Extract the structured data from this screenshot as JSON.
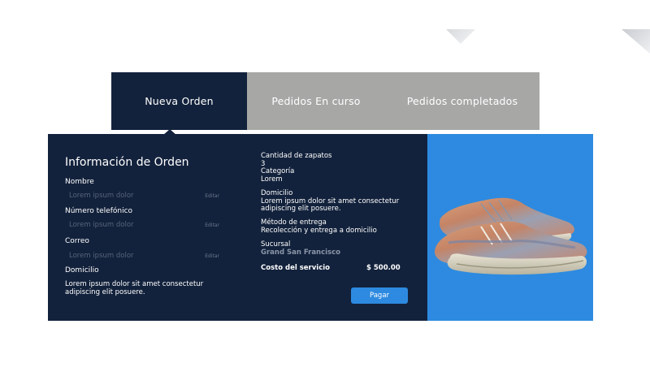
{
  "tabs": [
    {
      "label": "Nueva Orden",
      "active": true
    },
    {
      "label": "Pedidos En curso",
      "active": false
    },
    {
      "label": "Pedidos completados",
      "active": false
    }
  ],
  "form": {
    "title": "Información de Orden",
    "fields": [
      {
        "label": "Nombre",
        "placeholder": "Lorem ipsum dolor",
        "edit": "Editar"
      },
      {
        "label": "Número telefónico",
        "placeholder": "Lorem ipsum dolor",
        "edit": "Editar"
      },
      {
        "label": "Correo",
        "placeholder": "Lorem ipsum dolor",
        "edit": "Editar"
      }
    ],
    "address_label": "Domicilio",
    "address_line1": "Lorem ipsum dolor sit amet consectetur",
    "address_line2": "adipiscing elit posuere."
  },
  "summary": {
    "shoes_label": "Cantidad de zapatos",
    "shoes_value": "3",
    "category_label": "Categoría",
    "category_value": "Lorem",
    "address_label": "Domicilio",
    "address_line1": "Lorem ipsum dolor sit amet consectetur",
    "address_line2": "adipiscing elit posuere.",
    "delivery_label": "Método de entrega",
    "delivery_value": "Recolección y entrega a domicilio",
    "branch_label": "Sucursal",
    "branch_value": "Grand San Francisco",
    "cost_label": "Costo del servicio",
    "cost_value": "$ 500.00",
    "pay_button": "Pagar"
  },
  "colors": {
    "navy": "#13223c",
    "accent_blue": "#2d8ae0",
    "tab_gray": "#a7a7a6"
  },
  "icons": {
    "product_image": "sneaker-image"
  }
}
